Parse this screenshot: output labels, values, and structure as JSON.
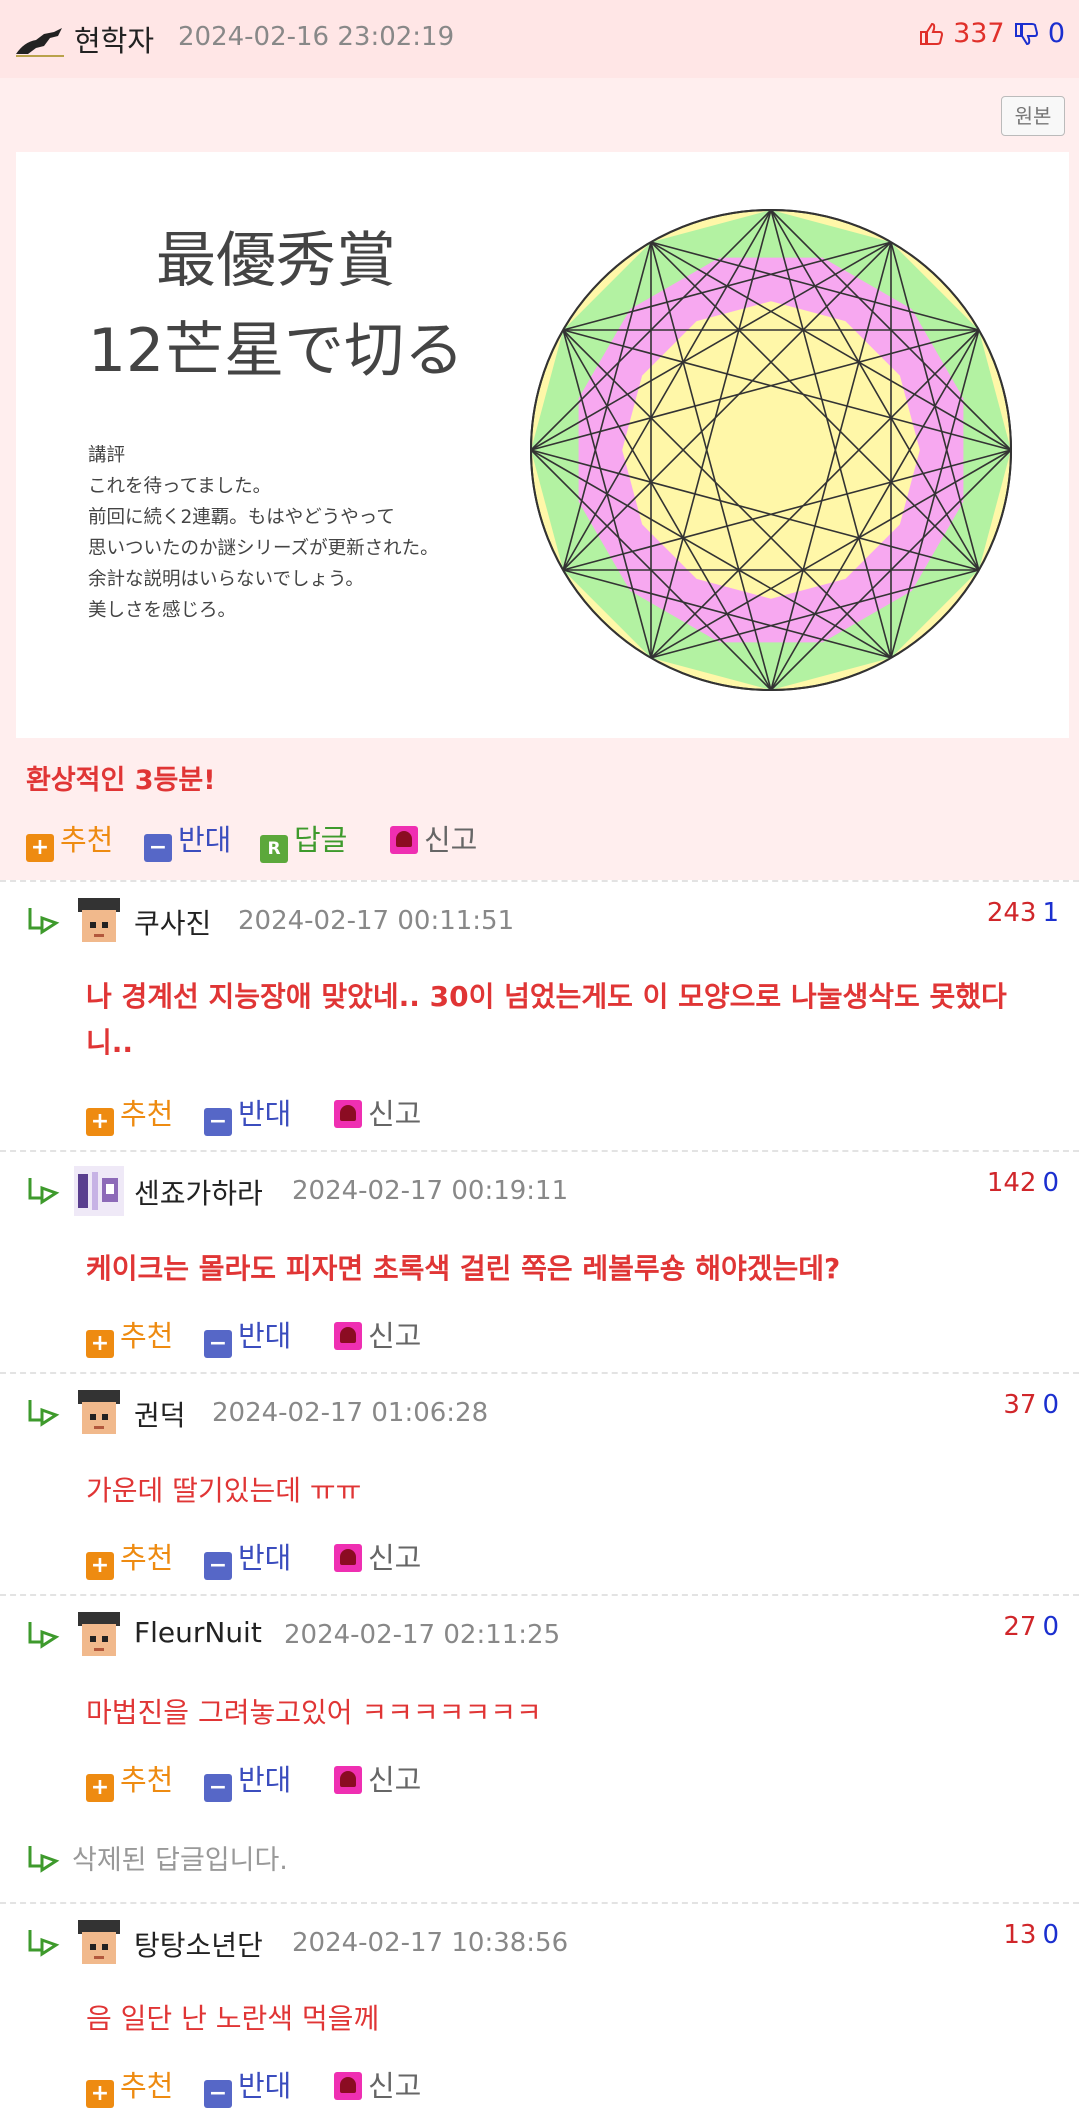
{
  "post": {
    "author": "현학자",
    "timestamp": "2024-02-16 23:02:19",
    "likes": "337",
    "dislikes": "0",
    "original_button": "원본",
    "image": {
      "title_line1": "最優秀賞",
      "title_line2": "12芒星で切る",
      "critique_lines": [
        "講評",
        "これを待ってました。",
        "前回に続く2連覇。もはやどうやって",
        "思いついたのか謎シリーズが更新された。",
        "余計な説明はいらないでしょう。",
        "美しさを感じろ。"
      ]
    },
    "text": "환상적인 3등분!",
    "actions": {
      "recommend": "추천",
      "oppose": "반대",
      "reply": "답글",
      "report": "신고"
    }
  },
  "comments": [
    {
      "author": "쿠사진",
      "timestamp": "2024-02-17 00:11:51",
      "likes": "243",
      "dislikes": "1",
      "text": "나 경계선 지능장애 맞았네.. 30이 넘었는게도 이 모양으로 나눌생삭도 못했다니.."
    },
    {
      "author": "센죠가하라",
      "timestamp": "2024-02-17 00:19:11",
      "likes": "142",
      "dislikes": "0",
      "text": "케이크는 몰라도 피자면 초록색 걸린 쪽은 레볼루숑 해야겠는데?"
    },
    {
      "author": "권덕",
      "timestamp": "2024-02-17 01:06:28",
      "likes": "37",
      "dislikes": "0",
      "text": "가운데 딸기있는데 ㅠㅠ"
    },
    {
      "author": "FleurNuit",
      "timestamp": "2024-02-17 02:11:25",
      "likes": "27",
      "dislikes": "0",
      "text": "마법진을 그려놓고있어 ㅋㅋㅋㅋㅋㅋㅋ"
    },
    {
      "deleted_text": "삭제된 답글입니다."
    },
    {
      "author": "탕탕소년단",
      "timestamp": "2024-02-17 10:38:56",
      "likes": "13",
      "dislikes": "0",
      "text": "음 일단 난 노란색 먹을께"
    }
  ],
  "comment_actions": {
    "recommend": "추천",
    "oppose": "반대",
    "report": "신고"
  },
  "colors": {
    "header_bg": "#ffe6e6",
    "post_bg": "#ffeeee",
    "accent_red": "#e03535",
    "up_orange": "#ee8b11",
    "down_blue": "#5667c7",
    "reply_green": "#5ca83b",
    "report_pink": "#ef2fb2"
  },
  "icons": [
    "logo-icon",
    "thumb-up-icon",
    "thumb-down-icon",
    "reply-arrow-icon",
    "avatar-icon",
    "plus-icon",
    "minus-icon",
    "reply-r-icon",
    "siren-icon"
  ]
}
